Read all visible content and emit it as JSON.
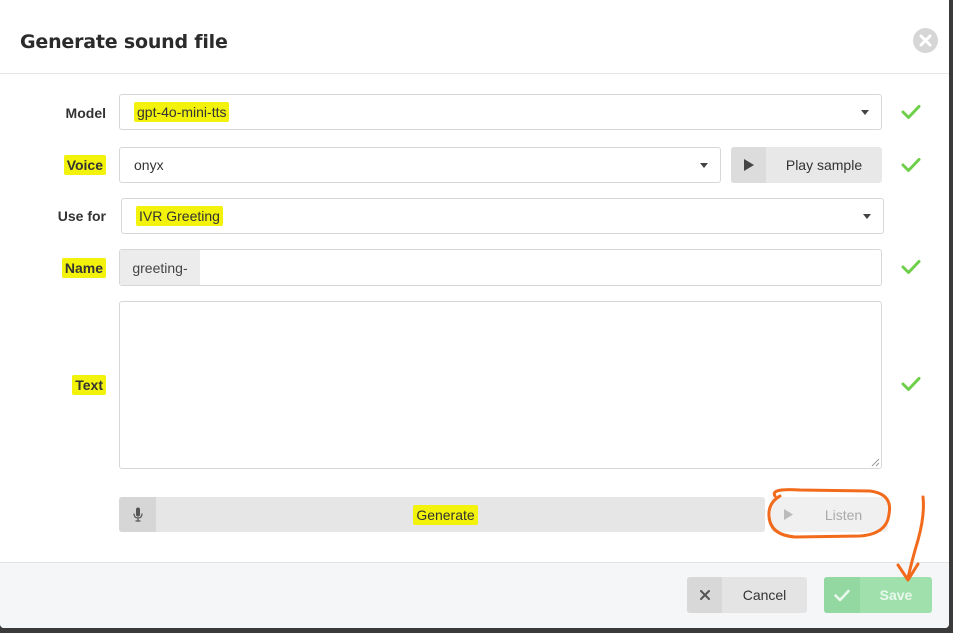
{
  "dialog": {
    "title": "Generate sound file"
  },
  "form": {
    "model": {
      "label": "Model",
      "value": "gpt-4o-mini-tts"
    },
    "voice": {
      "label": "Voice",
      "value": "onyx",
      "play_sample_label": "Play sample"
    },
    "use_for": {
      "label": "Use for",
      "value": "IVR Greeting"
    },
    "name": {
      "label": "Name",
      "prefix": "greeting-",
      "value": ""
    },
    "text": {
      "label": "Text",
      "value": ""
    },
    "generate_label": "Generate",
    "listen_label": "Listen"
  },
  "footer": {
    "cancel_label": "Cancel",
    "save_label": "Save"
  },
  "icons": {
    "close": "close-icon",
    "check": "check-icon",
    "play": "play-icon",
    "microphone": "microphone-icon",
    "x": "x-icon"
  },
  "colors": {
    "highlight": "#f2f20a",
    "check": "#6fcf4a",
    "save": "#9fe0ad",
    "annotation": "#f26a1b"
  }
}
